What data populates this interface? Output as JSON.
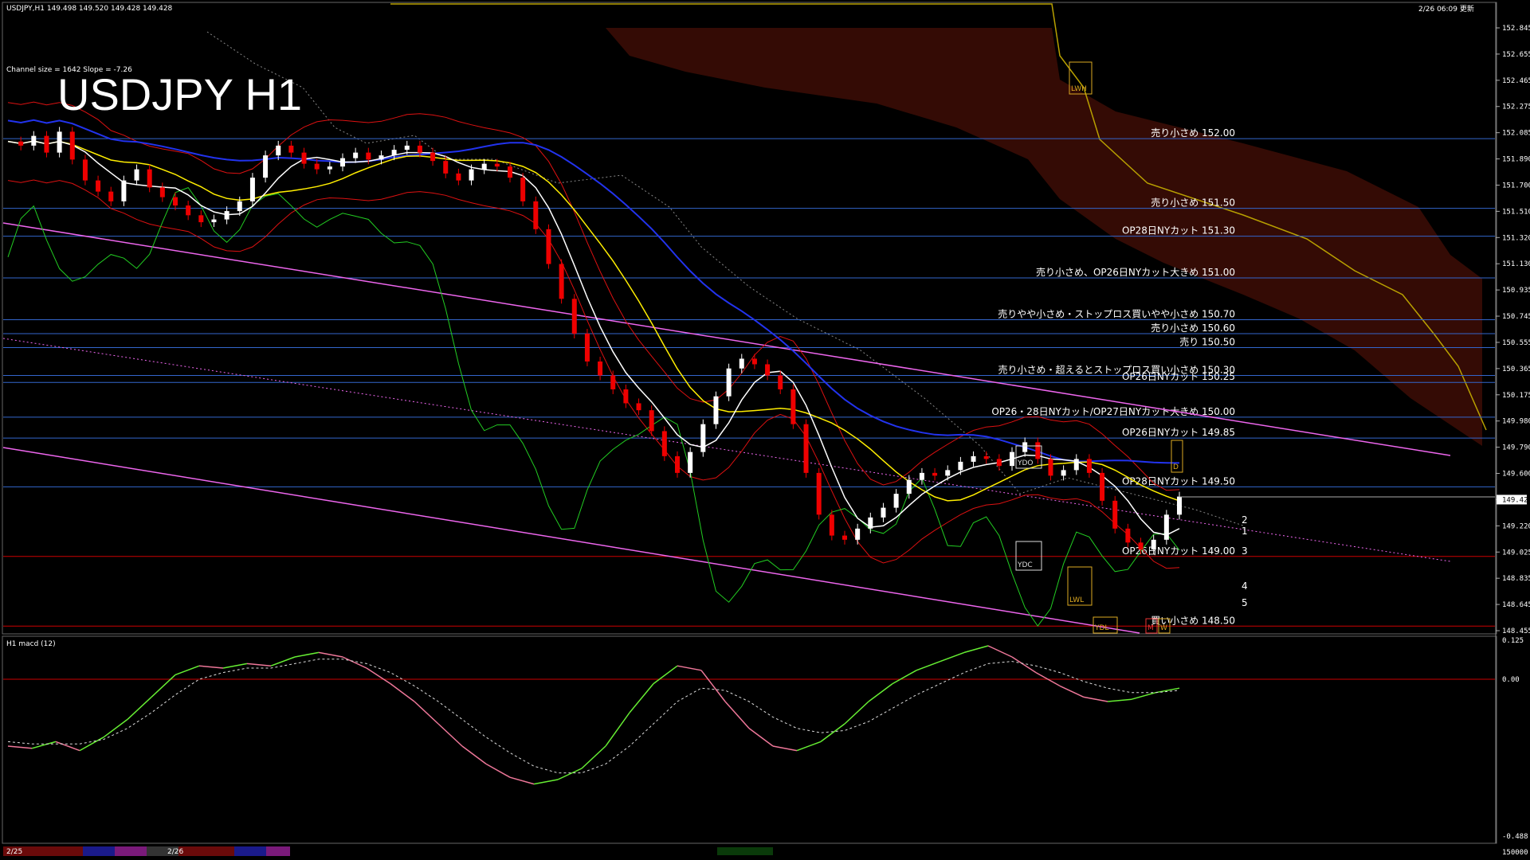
{
  "header": {
    "left_info": "USDJPY,H1  149.498 149.520 149.428 149.428",
    "timestamp": "2/26 06:09 更新",
    "channel_info": "Channel size = 1642 Slope = -7.26",
    "title": "USDJPY H1"
  },
  "chart_data": {
    "type": "line",
    "title": "USDJPY H1",
    "price_axis": {
      "ylim": [
        148.45,
        152.95
      ],
      "ticks": [
        "152.845",
        "152.655",
        "152.465",
        "152.275",
        "152.085",
        "151.890",
        "151.700",
        "151.510",
        "151.320",
        "151.130",
        "150.935",
        "150.745",
        "150.555",
        "150.365",
        "150.175",
        "149.980",
        "149.790",
        "149.600",
        "149.428",
        "149.220",
        "149.025",
        "148.835",
        "148.645",
        "148.455"
      ],
      "current": "149.428"
    },
    "levels": [
      {
        "price": 152.0,
        "label": "売り小さめ 152.00"
      },
      {
        "price": 151.5,
        "label": "売り小さめ 151.50"
      },
      {
        "price": 151.3,
        "label": "OP28日NYカット 151.30"
      },
      {
        "price": 151.0,
        "label": "売り小さめ、OP26日NYカット大きめ 151.00"
      },
      {
        "price": 150.7,
        "label": "売りやや小さめ・ストップロス買いやや小さめ 150.70"
      },
      {
        "price": 150.6,
        "label": "売り小さめ 150.60"
      },
      {
        "price": 150.5,
        "label": "売り 150.50"
      },
      {
        "price": 150.3,
        "label": "売り小さめ・超えるとストップロス買い小さめ 150.30"
      },
      {
        "price": 150.25,
        "label": "OP26日NYカット 150.25"
      },
      {
        "price": 150.0,
        "label": "OP26・28日NYカット/OP27日NYカット大きめ 150.00"
      },
      {
        "price": 149.85,
        "label": "OP26日NYカット 149.85"
      },
      {
        "price": 149.5,
        "label": "OP28日NYカット 149.50"
      },
      {
        "price": 149.0,
        "label": "OP26日NYカット 149.00"
      },
      {
        "price": 148.5,
        "label": "買い小さめ 148.50"
      }
    ],
    "price_series": [
      151.98,
      151.95,
      152.02,
      151.9,
      152.05,
      151.85,
      151.7,
      151.62,
      151.55,
      151.7,
      151.78,
      151.65,
      151.58,
      151.52,
      151.45,
      151.4,
      151.42,
      151.48,
      151.55,
      151.72,
      151.88,
      151.95,
      151.9,
      151.82,
      151.78,
      151.8,
      151.86,
      151.9,
      151.85,
      151.88,
      151.92,
      151.95,
      151.9,
      151.84,
      151.75,
      151.7,
      151.78,
      151.82,
      151.8,
      151.72,
      151.55,
      151.35,
      151.1,
      150.85,
      150.6,
      150.4,
      150.3,
      150.2,
      150.1,
      150.05,
      149.9,
      149.72,
      149.6,
      149.75,
      149.95,
      150.15,
      150.35,
      150.42,
      150.38,
      150.3,
      150.2,
      149.95,
      149.6,
      149.3,
      149.15,
      149.12,
      149.2,
      149.28,
      149.35,
      149.45,
      149.55,
      149.6,
      149.58,
      149.62,
      149.68,
      149.72,
      149.7,
      149.65,
      149.75,
      149.82,
      149.7,
      149.58,
      149.62,
      149.7,
      149.6,
      149.4,
      149.2,
      149.1,
      149.05,
      149.12,
      149.3,
      149.43
    ],
    "indicators": [
      "Ichimoku Kumo",
      "SMA",
      "Bollinger Bands",
      "Regression Channel"
    ],
    "markers": {
      "boxes": [
        "LWH",
        "YDO",
        "YDC",
        "LWL",
        "YDL",
        "D",
        "M",
        "W"
      ],
      "projection_labels": [
        "1",
        "2",
        "3",
        "4",
        "5"
      ],
      "bottom_dates": [
        "2/25",
        "2/26"
      ]
    },
    "macd": {
      "label": "H1  macd (12)",
      "ticks": [
        "0.125",
        "0.00",
        "-0.488",
        "150000"
      ],
      "series": [
        -0.3,
        -0.31,
        -0.28,
        -0.32,
        -0.26,
        -0.18,
        -0.08,
        0.02,
        0.06,
        0.05,
        0.07,
        0.06,
        0.1,
        0.12,
        0.1,
        0.05,
        -0.02,
        -0.1,
        -0.2,
        -0.3,
        -0.38,
        -0.44,
        -0.47,
        -0.45,
        -0.4,
        -0.3,
        -0.15,
        -0.02,
        0.06,
        0.04,
        -0.1,
        -0.22,
        -0.3,
        -0.32,
        -0.28,
        -0.2,
        -0.1,
        -0.02,
        0.04,
        0.08,
        0.12,
        0.15,
        0.1,
        0.03,
        -0.03,
        -0.08,
        -0.1,
        -0.09,
        -0.06,
        -0.04
      ],
      "signal": [
        -0.28,
        -0.29,
        -0.29,
        -0.29,
        -0.27,
        -0.22,
        -0.15,
        -0.07,
        0.0,
        0.03,
        0.05,
        0.05,
        0.07,
        0.09,
        0.09,
        0.07,
        0.03,
        -0.03,
        -0.1,
        -0.18,
        -0.26,
        -0.33,
        -0.39,
        -0.42,
        -0.42,
        -0.38,
        -0.3,
        -0.2,
        -0.1,
        -0.04,
        -0.05,
        -0.1,
        -0.17,
        -0.22,
        -0.24,
        -0.23,
        -0.19,
        -0.13,
        -0.07,
        -0.02,
        0.03,
        0.07,
        0.08,
        0.06,
        0.03,
        -0.01,
        -0.04,
        -0.06,
        -0.06,
        -0.05
      ]
    }
  },
  "colors": {
    "background": "#000000",
    "grid": "#3366cc",
    "ma_white": "#ffffff",
    "ma_yellow": "#ffee00",
    "ma_blue": "#2233ee",
    "bollinger": "#dd1111",
    "chikou": "#22cc22",
    "kumo": "#bb3311",
    "channel": "#ee66ee",
    "macd_up": "#66ee33",
    "macd_down": "#ee7799",
    "orange": "#ddaa22",
    "red_line": "#cc0000"
  }
}
